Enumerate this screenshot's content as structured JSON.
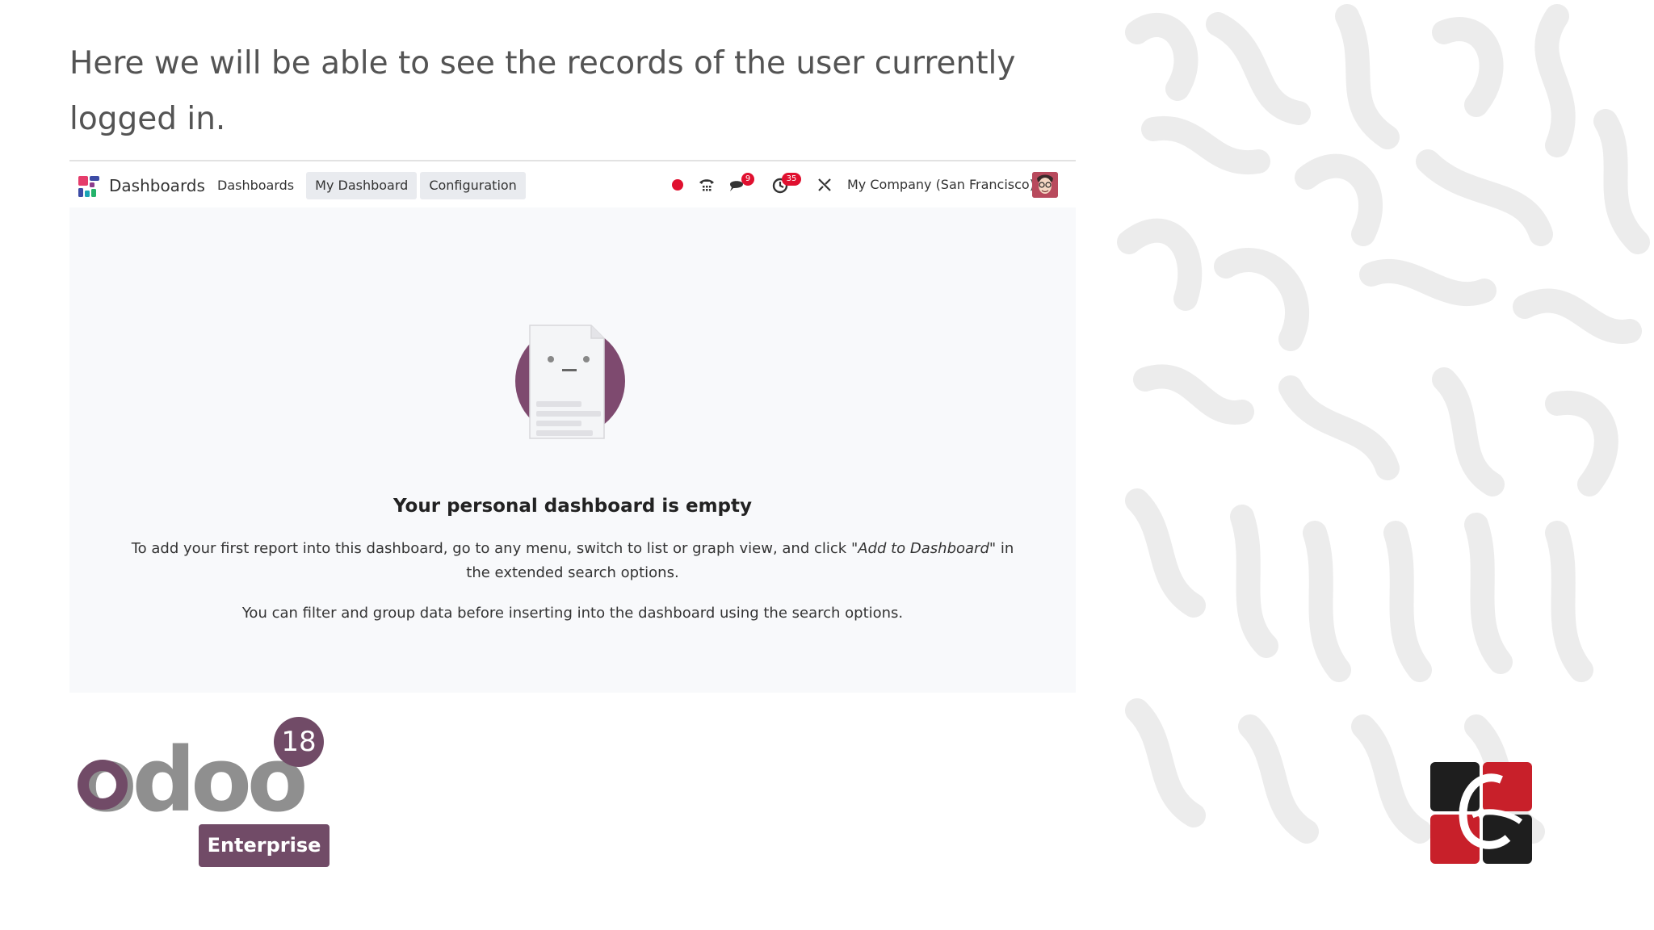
{
  "slide": {
    "title": "Here we  will be able to see the records of the user currently logged in."
  },
  "navbar": {
    "app_name": "Dashboards",
    "menu": [
      {
        "label": "Dashboards"
      },
      {
        "label": "My Dashboard"
      },
      {
        "label": "Configuration"
      }
    ],
    "chat_badge": "9",
    "activity_badge": "35",
    "company": "My Company (San Francisco)"
  },
  "empty_state": {
    "title": "Your personal dashboard is empty",
    "line1_before": "To add your first report into this dashboard, go to any menu, switch to list or graph view, and click ",
    "line1_em": "\"Add to Dashboard\"",
    "line1_after": " in the extended search options.",
    "line2": "You can filter and group data before inserting into the dashboard using the search options."
  },
  "branding": {
    "odoo_version": "18",
    "edition": "Enterprise",
    "logo_wordmark": "odoo",
    "accent_color": "#714b67"
  },
  "icons": [
    "apps-icon",
    "record-dot-icon",
    "phone-icon",
    "chat-icon",
    "activity-clock-icon",
    "tools-icon",
    "user-avatar"
  ]
}
